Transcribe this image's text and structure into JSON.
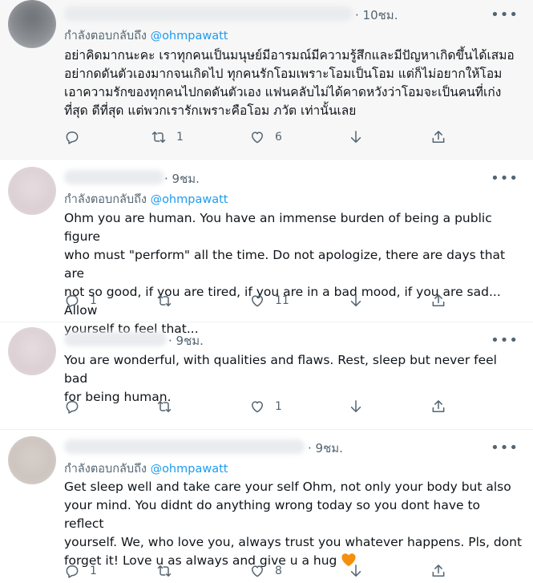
{
  "tweets": [
    {
      "time": "· 10ชม.",
      "reply_prefix": "กำลังตอบกลับถึง ",
      "reply_handle": "@ohmpawatt",
      "body": "อย่าคิดมากนะคะ เราทุกคนเป็นมนุษย์มีอารมณ์มีความรู้สึกและมีปัญหาเกิดขึ้นได้เสมอ\nอย่ากดดันตัวเองมากจนเกิดไป ทุกคนรักโอมเพราะโอมเป็นโอม แต่ก็ไม่อยากให้โอม\nเอาความรักของทุกคนไปกดดันตัวเอง แฟนคลับไม่ได้คาดหวังว่าโอมจะเป็นคนที่เก่ง\nที่สุด ดีที่สุด แต่พวกเรารักเพราะคือโอม ภวัต เท่านั้นเลย",
      "replies": "",
      "retweets": "1",
      "likes": "6"
    },
    {
      "time": "· 9ชม.",
      "reply_prefix": "กำลังตอบกลับถึง ",
      "reply_handle": "@ohmpawatt",
      "body": "Ohm you are human. You have an immense burden of being a public figure\nwho must \"perform\" all the time. Do not apologize, there are days that are\nnot so good, if you are tired, if you are in a bad mood, if you are sad... Allow\nyourself to feel that...",
      "replies": "1",
      "retweets": "",
      "likes": "11"
    },
    {
      "time": "· 9ชม.",
      "body": "You are wonderful, with qualities and flaws. Rest, sleep but never feel bad\nfor being human.",
      "replies": "",
      "retweets": "",
      "likes": "1"
    },
    {
      "time": "· 9ชม.",
      "reply_prefix": "กำลังตอบกลับถึง ",
      "reply_handle": "@ohmpawatt",
      "body": "Get sleep well and take care your self Ohm, not only your body but also\nyour mind. You didnt do anything wrong today so you dont have to reflect\nyourself. We, who love you, always trust you whatever happens. Pls, dont\nforget it! Love u as always and give u a hug",
      "replies": "1",
      "retweets": "",
      "likes": "8"
    }
  ],
  "more_label": "•••",
  "icons": [
    "reply-icon",
    "retweet-icon",
    "like-icon",
    "download-icon",
    "share-icon",
    "orange-heart-icon",
    "more-icon"
  ],
  "colors": {
    "accent": "#1d9bf0",
    "muted": "#536471",
    "text": "#0f1419",
    "highlight_bg": "#f7f7f7",
    "heart": "#f4900c"
  }
}
